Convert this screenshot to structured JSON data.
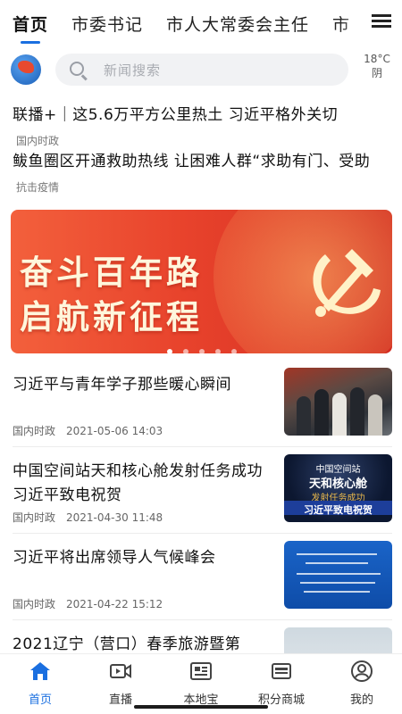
{
  "top_tabs": [
    "首页",
    "市委书记",
    "市人大常委会主任",
    "市"
  ],
  "search": {
    "placeholder": "新闻搜索"
  },
  "weather": {
    "temp": "18°C",
    "condition": "阴"
  },
  "headlines": [
    {
      "title": "联播+｜这5.6万平方公里热土 习近平格外关切",
      "tag": "国内时政"
    },
    {
      "title": "鲅鱼圈区开通救助热线 让困难人群“求助有门、受助",
      "tag": "抗击疫情"
    }
  ],
  "banner": {
    "line1": "奋斗百年路",
    "line2": "启航新征程",
    "dot_count": 5,
    "active_dot": 0
  },
  "news": [
    {
      "title": "习近平与青年学子那些暖心瞬间",
      "tag": "国内时政",
      "date": "2021-05-06 14:03",
      "thumb": "photo-xi-students"
    },
    {
      "title": "中国空间站天和核心舱发射任务成功 习近平致电祝贺",
      "tag": "国内时政",
      "date": "2021-04-30 11:48",
      "thumb": "photo-space-station",
      "thumb_text": {
        "top": "中国空间站",
        "mid": "天和核心舱",
        "sub": "发射任务成功",
        "strip": "习近平致电祝贺"
      }
    },
    {
      "title": "习近平将出席领导人气候峰会",
      "tag": "国内时政",
      "date": "2021-04-22 15:12",
      "thumb": "photo-climate-summit"
    },
    {
      "title": "2021辽宁（营口）春季旅游暨第",
      "tag": "",
      "date": "",
      "thumb": "photo-sky"
    }
  ],
  "bottom_tabs": [
    {
      "label": "首页",
      "icon": "home-icon",
      "active": true
    },
    {
      "label": "直播",
      "icon": "video-icon",
      "active": false
    },
    {
      "label": "本地宝",
      "icon": "newspaper-icon",
      "active": false
    },
    {
      "label": "积分商城",
      "icon": "store-icon",
      "active": false
    },
    {
      "label": "我的",
      "icon": "user-icon",
      "active": false
    }
  ],
  "colors": {
    "accent": "#1a6fe0",
    "banner_red": "#e8432c",
    "banner_text": "#fff6dc"
  }
}
